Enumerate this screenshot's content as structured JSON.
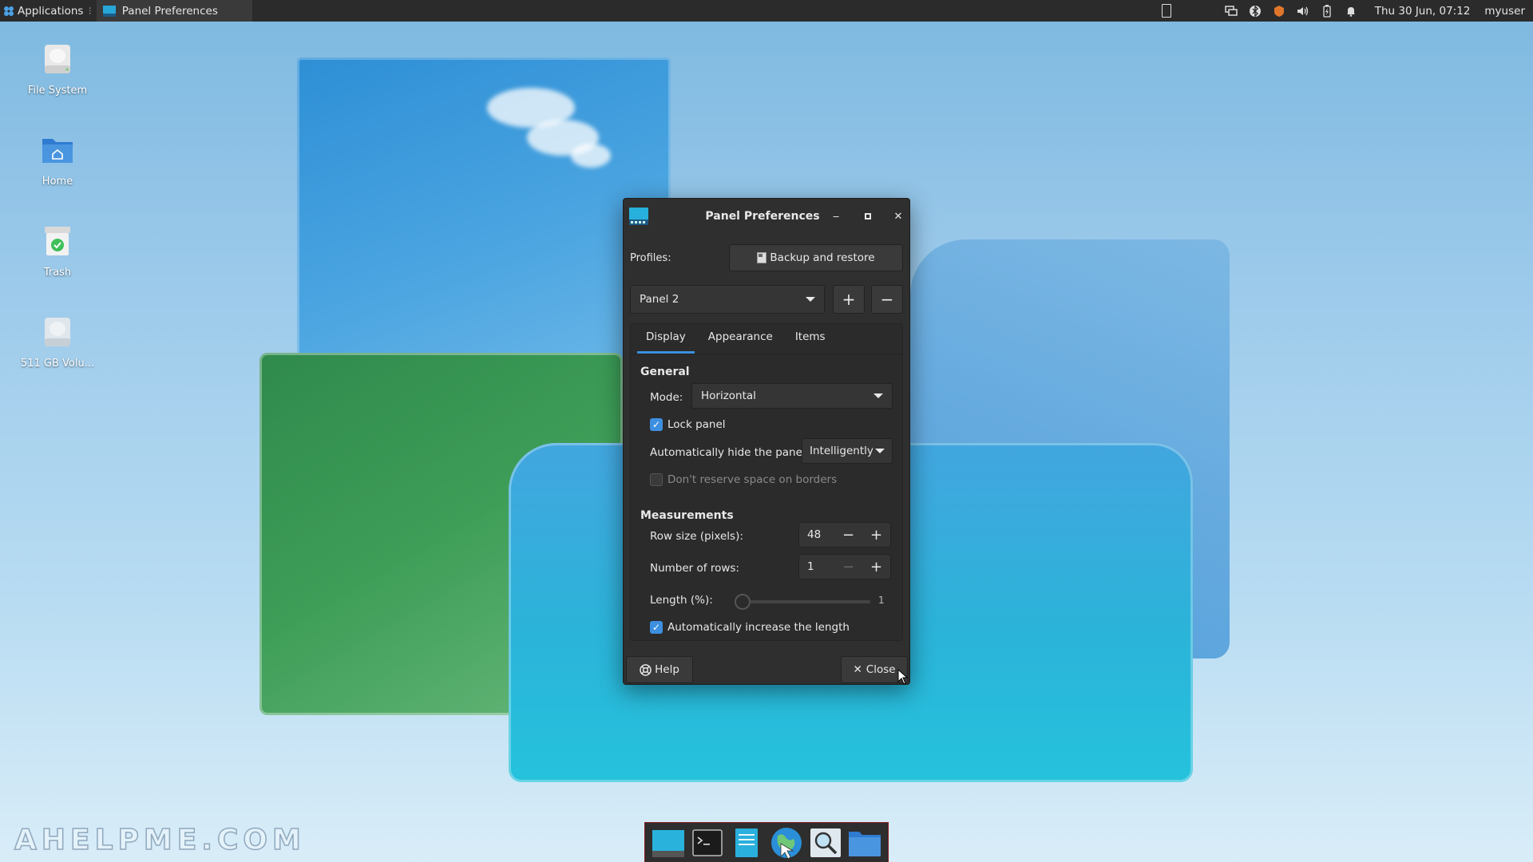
{
  "top_panel": {
    "applications_label": "Applications",
    "task_title": "Panel Preferences",
    "clock": "Thu 30 Jun, 07:12",
    "username": "myuser"
  },
  "desktop": {
    "icons": [
      {
        "label": "File System"
      },
      {
        "label": "Home"
      },
      {
        "label": "Trash"
      },
      {
        "label": "511 GB Volu..."
      }
    ],
    "watermark": "AHELPME.COM"
  },
  "dialog": {
    "title": "Panel Preferences",
    "profiles_label": "Profiles:",
    "backup_button": "Backup and restore",
    "panel_select": "Panel 2",
    "tabs": [
      {
        "label": "Display",
        "active": true
      },
      {
        "label": "Appearance",
        "active": false
      },
      {
        "label": "Items",
        "active": false
      }
    ],
    "general": {
      "title": "General",
      "mode_label": "Mode:",
      "mode_value": "Horizontal",
      "lock_panel_label": "Lock panel",
      "lock_panel_checked": true,
      "autohide_label": "Automatically hide the panel:",
      "autohide_value": "Intelligently",
      "reserve_label": "Don't reserve space on borders",
      "reserve_checked": false
    },
    "measurements": {
      "title": "Measurements",
      "row_size_label": "Row size (pixels):",
      "row_size_value": "48",
      "rows_label": "Number of rows:",
      "rows_value": "1",
      "length_label": "Length (%):",
      "length_value": "1",
      "auto_length_label": "Automatically increase the length",
      "auto_length_checked": true
    },
    "help_button": "Help",
    "close_button": "Close"
  },
  "colors": {
    "accent": "#3d8fe0",
    "dialog_bg": "#2f2f2f",
    "panel_bg": "#2b2b2b"
  }
}
